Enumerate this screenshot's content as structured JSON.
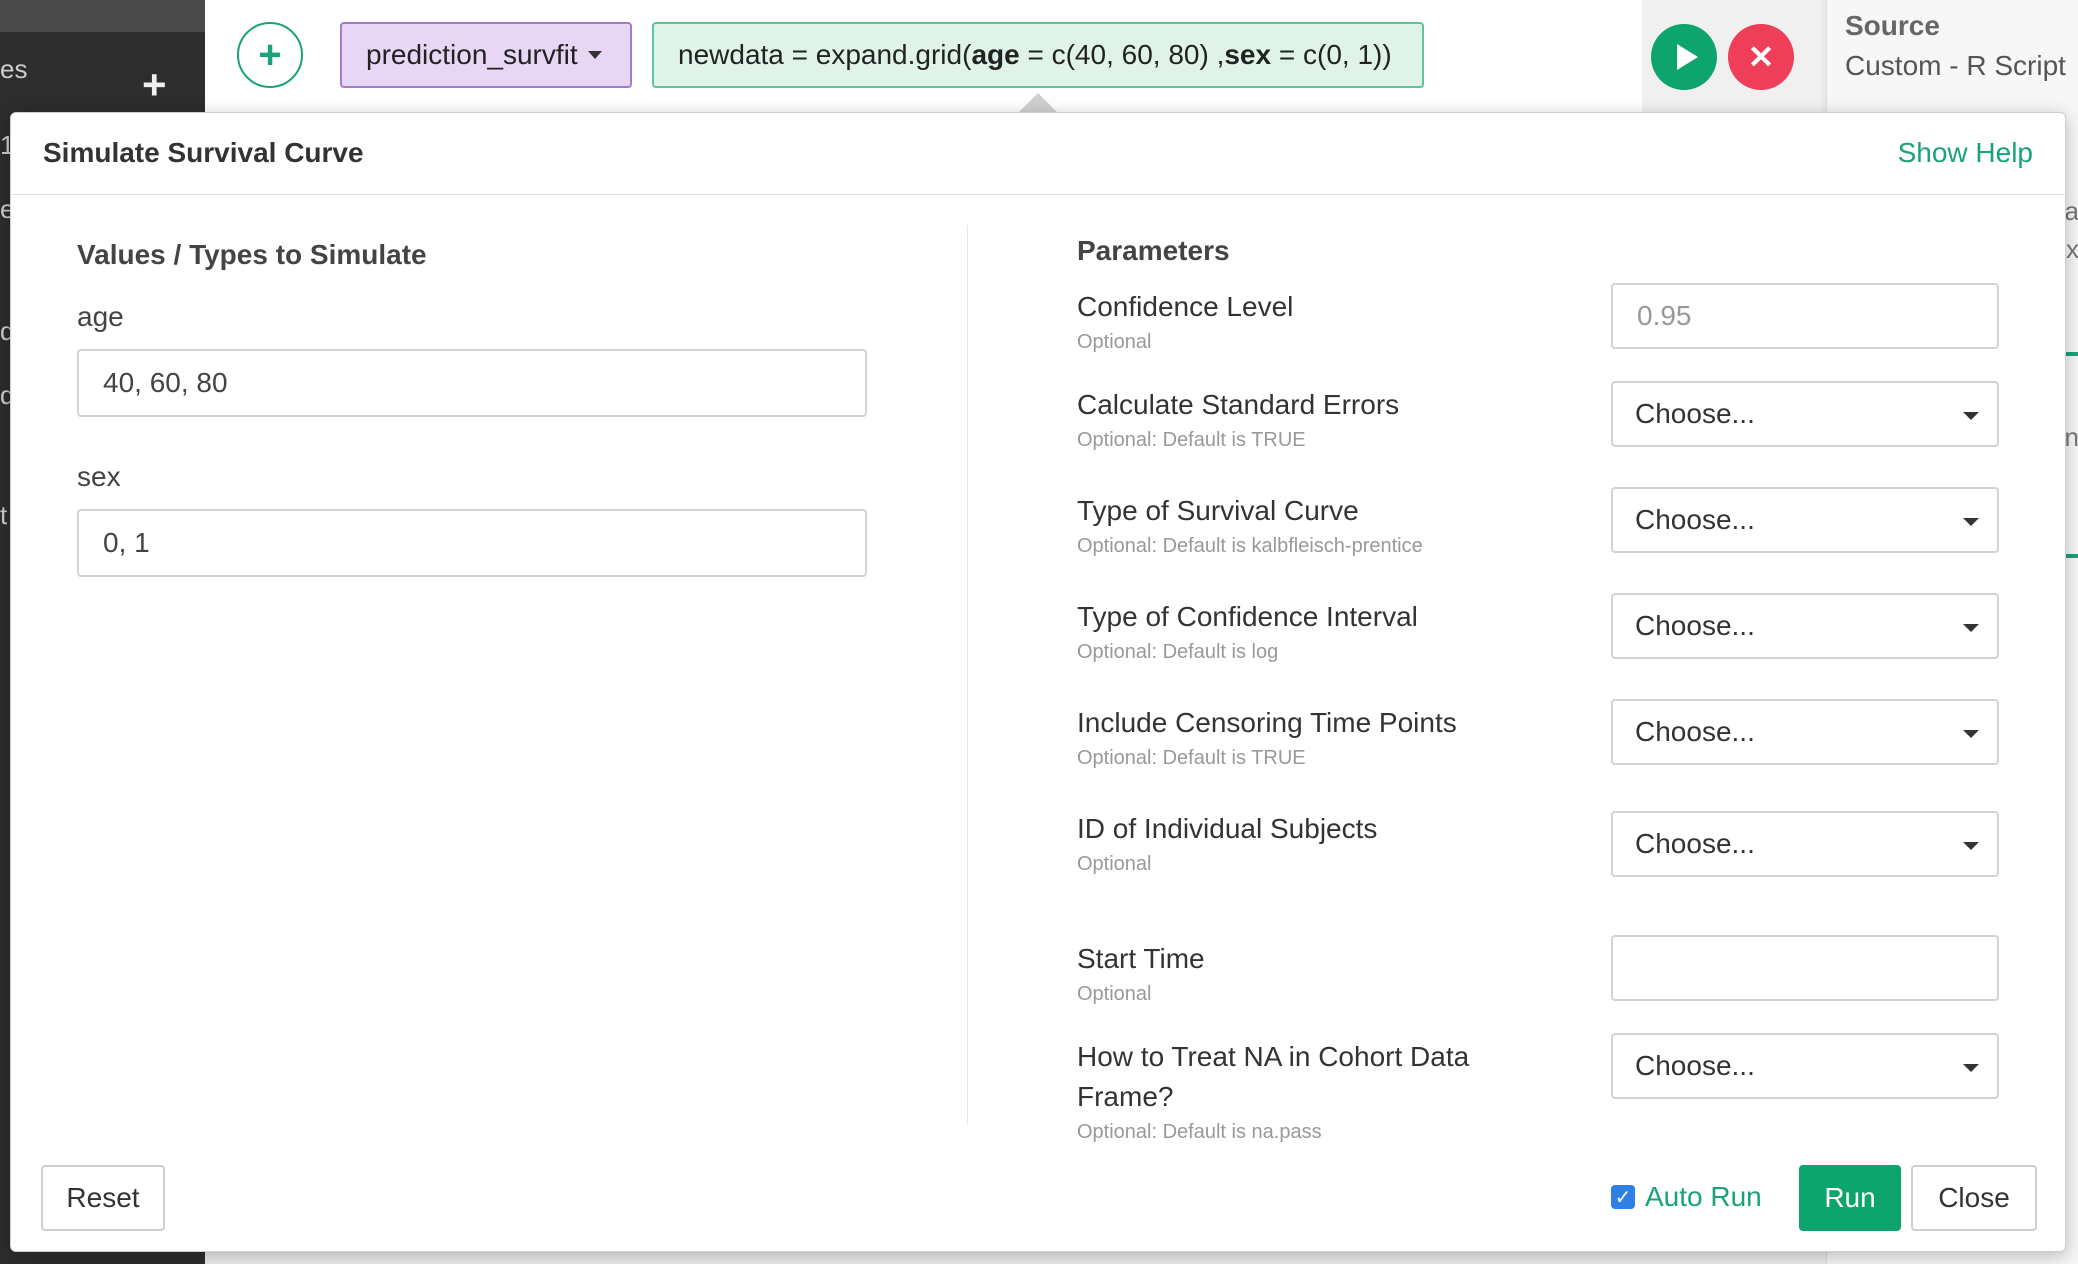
{
  "sidebar": {
    "frag_top": "es",
    "frag_1": "1",
    "frag_2": "e",
    "frag_3": "d",
    "frag_4": "d",
    "frag_5": "t"
  },
  "command": {
    "function_name": "prediction_survfit",
    "expr_prefix": "newdata = expand.grid(",
    "expr_age_key": "age",
    "expr_age_val": " = c(40, 60, 80) ,",
    "expr_sex_key": "sex",
    "expr_sex_val": " = c(0, 1))"
  },
  "source_panel": {
    "title": "Source",
    "subtitle": "Custom - R Script",
    "frag_1": "ra",
    "frag_2": "ex",
    "frag_3": "n"
  },
  "dialog": {
    "title": "Simulate Survival Curve",
    "help_link": "Show Help",
    "left": {
      "section_title": "Values / Types to Simulate",
      "age_label": "age",
      "age_value": "40, 60, 80",
      "sex_label": "sex",
      "sex_value": "0, 1"
    },
    "parameters": {
      "section_title": "Parameters",
      "confidence_level": {
        "label": "Confidence Level",
        "hint": "Optional",
        "placeholder": "0.95"
      },
      "std_errors": {
        "label": "Calculate Standard Errors",
        "hint": "Optional: Default is TRUE",
        "value": "Choose..."
      },
      "curve_type": {
        "label": "Type of Survival Curve",
        "hint": "Optional: Default is kalbfleisch-prentice",
        "value": "Choose..."
      },
      "ci_type": {
        "label": "Type of Confidence Interval",
        "hint": "Optional: Default is log",
        "value": "Choose..."
      },
      "censor": {
        "label": "Include Censoring Time Points",
        "hint": "Optional: Default is TRUE",
        "value": "Choose..."
      },
      "subject_id": {
        "label": "ID of Individual Subjects",
        "hint": "Optional",
        "value": "Choose..."
      },
      "start_time": {
        "label": "Start Time",
        "hint": "Optional",
        "value": ""
      },
      "na_action": {
        "label": "How to Treat NA in Cohort Data Frame?",
        "hint": "Optional: Default is na.pass",
        "value": "Choose..."
      }
    },
    "footer": {
      "reset_label": "Reset",
      "auto_run_label": "Auto Run",
      "auto_run_checked": true,
      "run_label": "Run",
      "close_label": "Close"
    }
  },
  "colors": {
    "accent_green": "#0ea46e",
    "cancel_red": "#ef3e58",
    "function_purple": "#e7d7f4",
    "expr_green": "#dff3e9",
    "checkbox_blue": "#2f7fe6"
  },
  "icons": {
    "add": "plus-icon",
    "run": "play-icon",
    "cancel": "close-icon",
    "dropdown": "chevron-down-icon",
    "checkbox": "check-icon"
  }
}
